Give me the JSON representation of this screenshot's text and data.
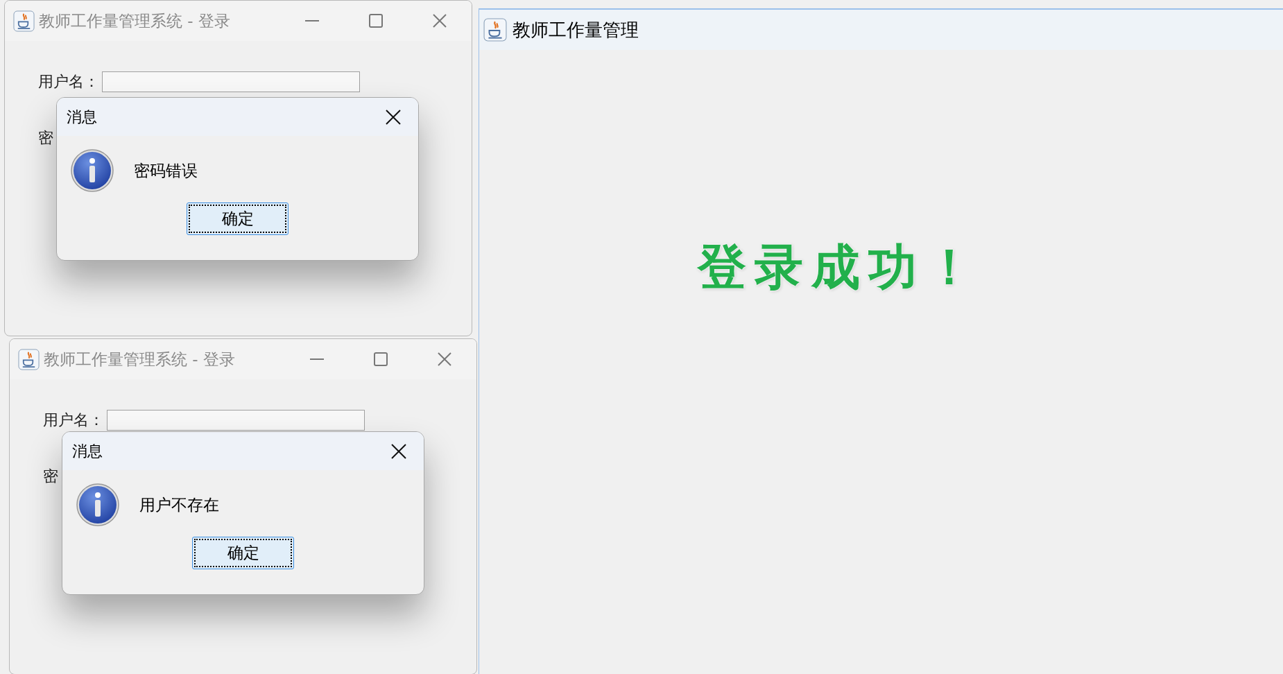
{
  "login_windows": [
    {
      "title": "教师工作量管理系统 - 登录",
      "username_label": "用户名：",
      "password_label": "密",
      "dialog": {
        "title": "消息",
        "message": "密码错误",
        "button": "确定"
      }
    },
    {
      "title": "教师工作量管理系统 - 登录",
      "username_label": "用户名：",
      "password_label": "密",
      "dialog": {
        "title": "消息",
        "message": "用户不存在",
        "button": "确定"
      }
    }
  ],
  "main_window": {
    "title": "教师工作量管理",
    "message": "登录成功！"
  }
}
